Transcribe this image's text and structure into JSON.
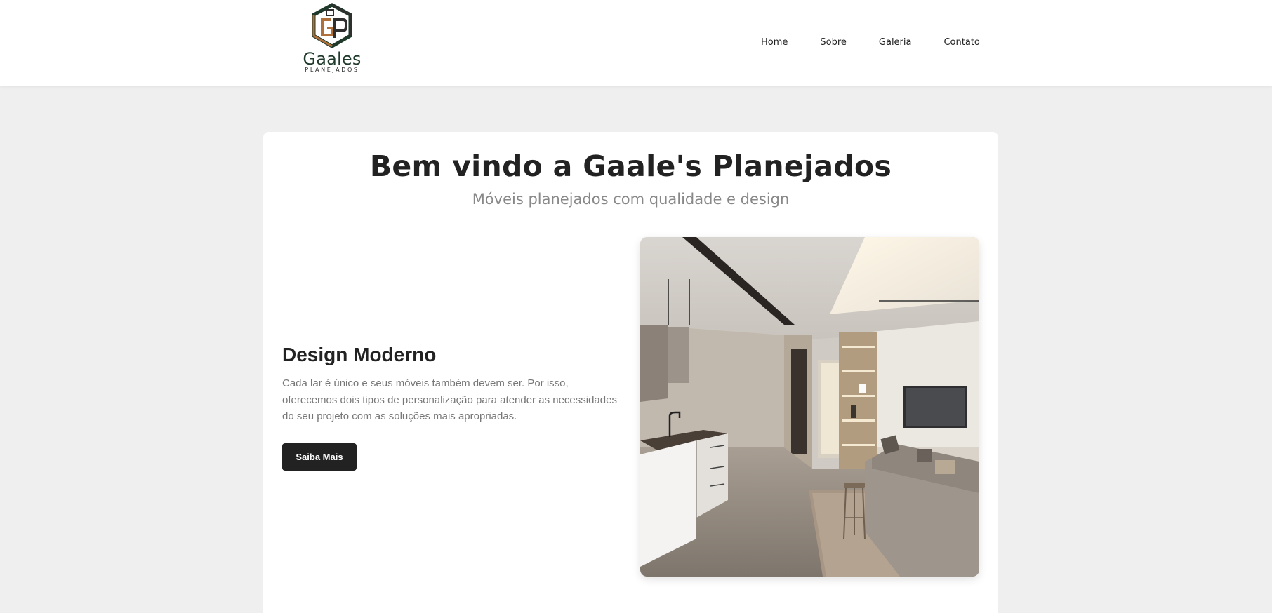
{
  "brand": {
    "name": "Gaales",
    "tagline": "PLANEJADOS",
    "logo_icon": "cube-gp-logo-icon"
  },
  "nav": {
    "items": [
      {
        "label": "Home"
      },
      {
        "label": "Sobre"
      },
      {
        "label": "Galeria"
      },
      {
        "label": "Contato"
      }
    ]
  },
  "hero": {
    "title": "Bem vindo a Gaale's Planejados",
    "subtitle": "Móveis planejados com qualidade e design"
  },
  "feature": {
    "title": "Design Moderno",
    "text": "Cada lar é único e seus móveis também devem ser. Por isso, oferecemos dois tipos de personalização para atender as necessidades do seu projeto com as soluções mais apropriadas.",
    "button_label": "Saiba Mais",
    "image": "modern-kitchen-living-room-photo"
  },
  "colors": {
    "page_bg": "#efefef",
    "card_bg": "#ffffff",
    "button_bg": "#222222",
    "logo_green": "#1f3a2b",
    "logo_copper": "#b0703a"
  }
}
